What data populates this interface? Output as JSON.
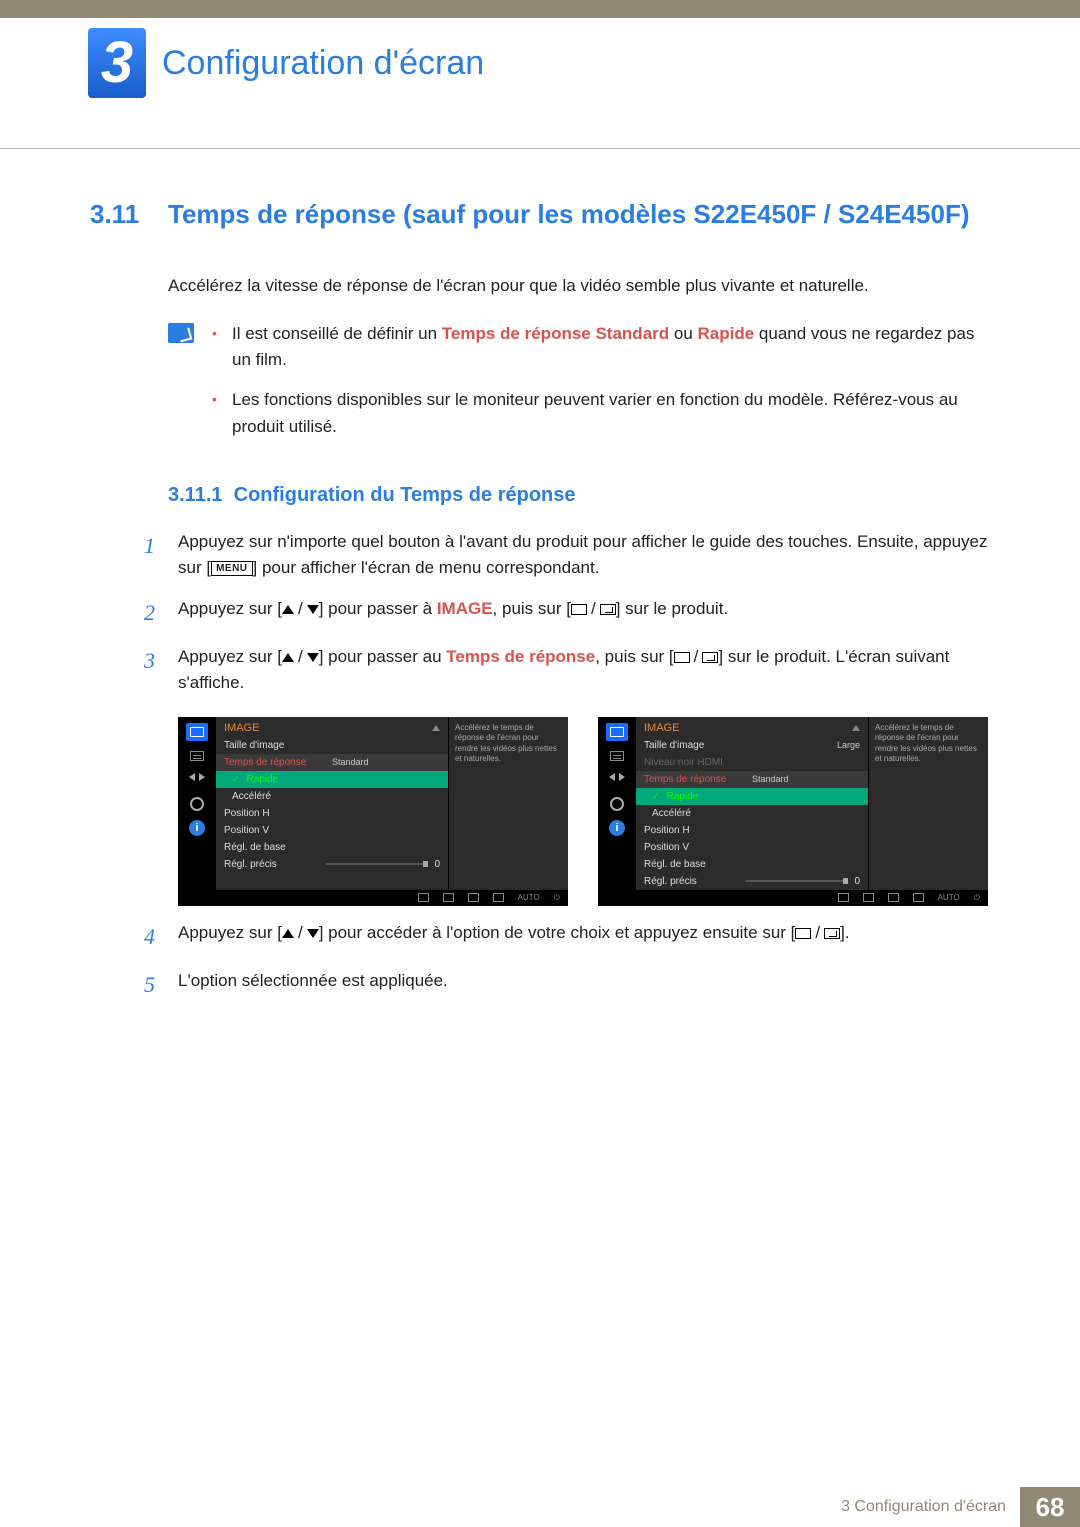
{
  "chapter": {
    "number": "3",
    "title": "Configuration d'écran"
  },
  "section": {
    "number": "3.11",
    "title": "Temps de réponse (sauf pour les modèles S22E450F / S24E450F)"
  },
  "intro": "Accélérez la vitesse de réponse de l'écran pour que la vidéo semble plus vivante et naturelle.",
  "notes": [
    {
      "pre": "Il est conseillé de définir un ",
      "red1": "Temps de réponse",
      "bold": " Standard",
      "mid": " ou ",
      "red2": "Rapide",
      "post": " quand vous ne regardez pas un film."
    },
    {
      "plain": "Les fonctions disponibles sur le moniteur peuvent varier en fonction du modèle. Référez-vous au produit utilisé."
    }
  ],
  "subsection": {
    "number": "3.11.1",
    "title": "Configuration du Temps de réponse"
  },
  "steps": {
    "s1a": "Appuyez sur n'importe quel bouton à l'avant du produit pour afficher le guide des touches. Ensuite, appuyez sur [",
    "s1menu": "MENU",
    "s1b": "] pour afficher l'écran de menu correspondant.",
    "s2a": "Appuyez sur [",
    "s2b": "] pour passer à ",
    "s2img": "IMAGE",
    "s2c": ", puis sur [",
    "s2d": "] sur le produit.",
    "s3a": "Appuyez sur [",
    "s3b": "] pour passer au ",
    "s3resp": "Temps de réponse",
    "s3c": ", puis sur [",
    "s3d": "] sur le produit. L'écran suivant s'affiche.",
    "s4a": "Appuyez sur [",
    "s4b": "] pour accéder à l'option de votre choix et appuyez ensuite sur [",
    "s4c": "].",
    "s5": "L'option sélectionnée est appliquée."
  },
  "osd": {
    "title": "IMAGE",
    "help": "Accélérez le temps de réponse de l'écran pour rendre les vidéos plus nettes et naturelles.",
    "left": {
      "items": [
        "Taille d'image",
        "Temps de réponse",
        "Position H",
        "Position V",
        "Régl. de base",
        "Régl. précis"
      ],
      "opts": [
        "Standard",
        "Rapide",
        "Accéléré"
      ],
      "sliderVal": "0"
    },
    "right": {
      "items": [
        "Taille d'image",
        "Niveau noir HDMI",
        "Temps de réponse",
        "Position H",
        "Position V",
        "Régl. de base",
        "Régl. précis"
      ],
      "val_large": "Large",
      "opts": [
        "Standard",
        "Rapide",
        "Accéléré"
      ],
      "sliderVal": "0"
    },
    "bottom_auto": "AUTO"
  },
  "footer": {
    "text": "3 Configuration d'écran",
    "page": "68"
  }
}
